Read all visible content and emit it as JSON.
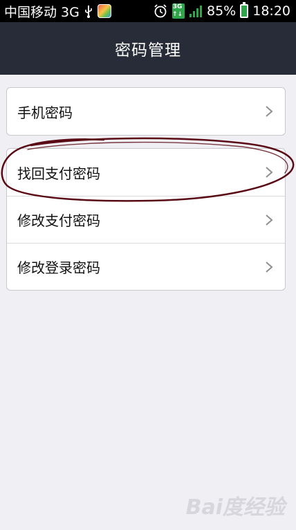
{
  "status_bar": {
    "carrier": "中国移动 3G",
    "battery": "85%",
    "time": "18:20"
  },
  "nav": {
    "title": "密码管理"
  },
  "groups": [
    {
      "items": [
        {
          "label": "手机密码"
        }
      ]
    },
    {
      "items": [
        {
          "label": "找回支付密码"
        },
        {
          "label": "修改支付密码"
        },
        {
          "label": "修改登录密码"
        }
      ]
    }
  ],
  "watermark": "Bai度经验",
  "colors": {
    "nav_background": "#272c38",
    "page_background": "#efeff4",
    "annotation": "#5a0a14"
  }
}
